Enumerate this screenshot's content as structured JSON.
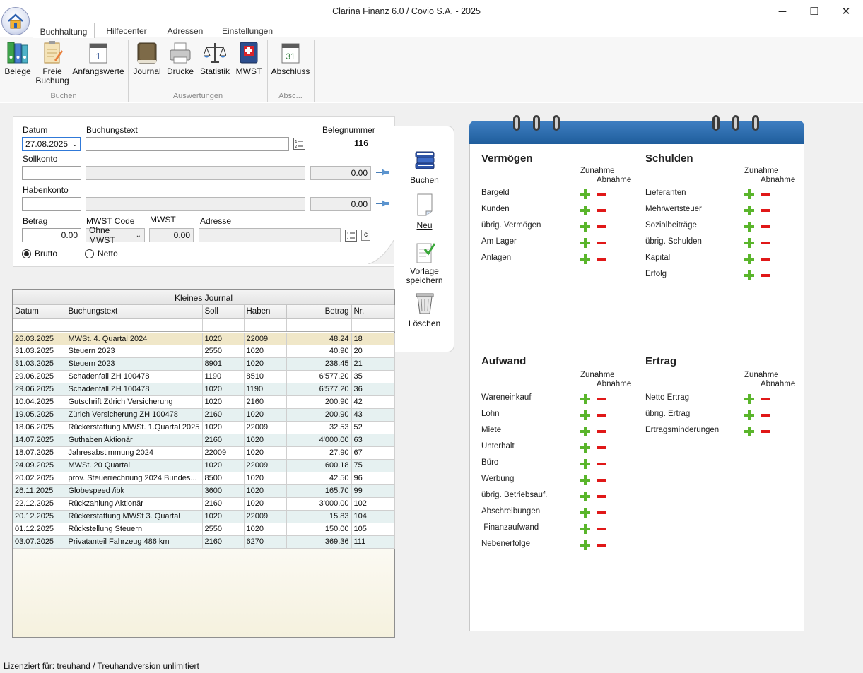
{
  "window": {
    "title": "Clarina Finanz 6.0 / Covio S.A. - 2025",
    "minimize": "─",
    "maximize": "☐",
    "close": "✕"
  },
  "tabs": [
    "Buchhaltung",
    "Hilfecenter",
    "Adressen",
    "Einstellungen"
  ],
  "ribbon": {
    "buttons": {
      "belege": "Belege",
      "freie1": "Freie",
      "freie2": "Buchung",
      "anfangswerte": "Anfangswerte",
      "journal": "Journal",
      "drucke": "Drucke",
      "statistik": "Statistik",
      "mwst": "MWST",
      "abschluss": "Abschluss"
    },
    "groups": {
      "buchen": "Buchen",
      "auswertungen": "Auswertungen",
      "abschluss": "Absc..."
    },
    "calendar_day": "1",
    "calendar_day2": "31"
  },
  "form": {
    "datum_label": "Datum",
    "datum_value": "27.08.2025",
    "buchungstext_label": "Buchungstext",
    "buchungstext_value": "",
    "belegnummer_label": "Belegnummer",
    "belegnummer_value": "116",
    "sollkonto_label": "Sollkonto",
    "soll_amount": "0.00",
    "habenkonto_label": "Habenkonto",
    "haben_amount": "0.00",
    "betrag_label": "Betrag",
    "betrag_value": "0.00",
    "mwst_code_label": "MWST Code",
    "mwst_code_value": "Ohne MWST",
    "mwst_label": "MWST",
    "mwst_value": "0.00",
    "adresse_label": "Adresse",
    "brutto_label": "Brutto",
    "netto_label": "Netto",
    "c_button": "c"
  },
  "side": {
    "buchen": "Buchen",
    "neu": "Neu",
    "vorlage1": "Vorlage",
    "vorlage2": "speichern",
    "loeschen": "Löschen"
  },
  "journal": {
    "title": "Kleines Journal",
    "headers": [
      "Datum",
      "Buchungstext",
      "Soll",
      "Haben",
      "Betrag",
      "Nr."
    ],
    "rows": [
      [
        "26.03.2025",
        "MWSt. 4. Quartal 2024",
        "1020",
        "22009",
        "48.24",
        "18"
      ],
      [
        "31.03.2025",
        "Steuern 2023",
        "2550",
        "1020",
        "40.90",
        "20"
      ],
      [
        "31.03.2025",
        "Steuern 2023",
        "8901",
        "1020",
        "238.45",
        "21"
      ],
      [
        "29.06.2025",
        "Schadenfall ZH 100478",
        "1190",
        "8510",
        "6'577.20",
        "35"
      ],
      [
        "29.06.2025",
        "Schadenfall ZH 100478",
        "1020",
        "1190",
        "6'577.20",
        "36"
      ],
      [
        "10.04.2025",
        "Gutschrift Zürich Versicherung",
        "1020",
        "2160",
        "200.90",
        "42"
      ],
      [
        "19.05.2025",
        "Zürich Versicherung ZH 100478",
        "2160",
        "1020",
        "200.90",
        "43"
      ],
      [
        "18.06.2025",
        "Rückerstattung MWSt. 1.Quartal 2025",
        "1020",
        "22009",
        "32.53",
        "52"
      ],
      [
        "14.07.2025",
        "Guthaben Aktionär",
        "2160",
        "1020",
        "4'000.00",
        "63"
      ],
      [
        "18.07.2025",
        "Jahresabstimmung 2024",
        "22009",
        "1020",
        "27.90",
        "67"
      ],
      [
        "24.09.2025",
        "MWSt. 20 Quartal",
        "1020",
        "22009",
        "600.18",
        "75"
      ],
      [
        "20.02.2025",
        "prov. Steuerrechnung 2024 Bundes...",
        "8500",
        "1020",
        "42.50",
        "96"
      ],
      [
        "26.11.2025",
        "Globespeed /ibk",
        "3600",
        "1020",
        "165.70",
        "99"
      ],
      [
        "22.12.2025",
        "Rückzahlung Aktionär",
        "2160",
        "1020",
        "3'000.00",
        "102"
      ],
      [
        "20.12.2025",
        "Rückerstattung MWSt 3. Quartal",
        "1020",
        "22009",
        "15.83",
        "104"
      ],
      [
        "01.12.2025",
        "Rückstellung Steuern",
        "2550",
        "1020",
        "150.00",
        "105"
      ],
      [
        "03.07.2025",
        "Privatanteil Fahrzeug 486 km",
        "2160",
        "6270",
        "369.36",
        "111"
      ]
    ]
  },
  "notebook": {
    "zunahme": "Zunahme",
    "abnahme": "Abnahme",
    "vermoegen": {
      "title": "Vermögen",
      "items": [
        "Bargeld",
        "Kunden",
        "übrig. Vermögen",
        "Am Lager",
        "Anlagen"
      ]
    },
    "schulden": {
      "title": "Schulden",
      "items": [
        "Lieferanten",
        "Mehrwertsteuer",
        "Sozialbeiträge",
        "übrig. Schulden",
        "Kapital",
        "Erfolg"
      ]
    },
    "aufwand": {
      "title": "Aufwand",
      "items": [
        "Wareneinkauf",
        "Lohn",
        "Miete",
        "Unterhalt",
        "Büro",
        "Werbung",
        "übrig. Betriebsauf.",
        "Abschreibungen",
        " Finanzaufwand",
        "Nebenerfolge"
      ]
    },
    "ertrag": {
      "title": "Ertrag",
      "items": [
        "Netto Ertrag",
        "übrig. Ertrag",
        "Ertragsminderungen"
      ]
    }
  },
  "status": {
    "text": "Lizenziert für: treuhand / Treuhandversion unlimitiert"
  }
}
